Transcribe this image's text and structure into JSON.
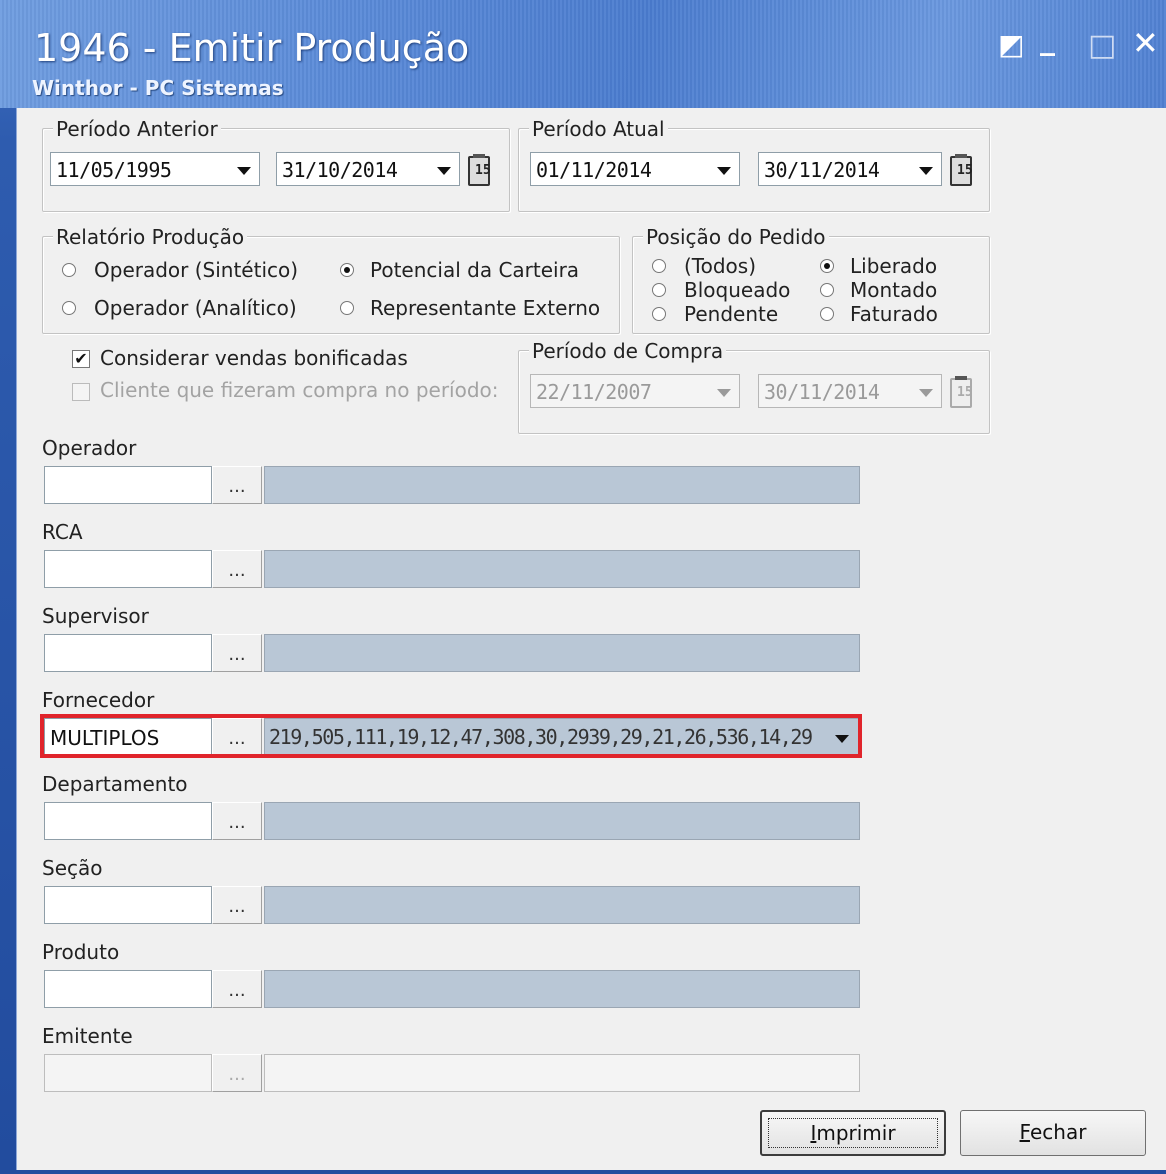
{
  "window": {
    "title": "1946 - Emitir Produção",
    "subtitle": "Winthor - PC Sistemas",
    "controls": {
      "restore": "◩",
      "minimize": "_",
      "maximize": "□",
      "close": "✕"
    }
  },
  "periodo_anterior": {
    "label": "Período Anterior",
    "start": "11/05/1995",
    "end": "31/10/2014"
  },
  "periodo_atual": {
    "label": "Período Atual",
    "start": "01/11/2014",
    "end": "30/11/2014"
  },
  "relatorio_producao": {
    "label": "Relatório Produção",
    "options": [
      "Operador (Sintético)",
      "Potencial da Carteira",
      "Operador (Analítico)",
      "Representante Externo"
    ],
    "selected": "Potencial da Carteira"
  },
  "posicao_pedido": {
    "label": "Posição do Pedido",
    "options": [
      "(Todos)",
      "Liberado",
      "Bloqueado",
      "Montado",
      "Pendente",
      "Faturado"
    ],
    "selected": "Liberado"
  },
  "checkboxes": {
    "vendas_bonificadas": {
      "label": "Considerar vendas bonificadas",
      "checked": true
    },
    "cliente_compra": {
      "label": "Cliente que fizeram compra no período:",
      "checked": false,
      "disabled": true
    }
  },
  "periodo_compra": {
    "label": "Período de Compra",
    "start": "22/11/2007",
    "end": "30/11/2014",
    "disabled": true
  },
  "filters": {
    "operador": {
      "label": "Operador",
      "code": "",
      "desc": ""
    },
    "rca": {
      "label": "RCA",
      "code": "",
      "desc": ""
    },
    "supervisor": {
      "label": "Supervisor",
      "code": "",
      "desc": ""
    },
    "fornecedor": {
      "label": "Fornecedor",
      "code": "MULTIPLOS",
      "desc": "219,505,111,19,12,47,308,30,2939,29,21,26,536,14,29"
    },
    "departamento": {
      "label": "Departamento",
      "code": "",
      "desc": ""
    },
    "secao": {
      "label": "Seção",
      "code": "",
      "desc": ""
    },
    "produto": {
      "label": "Produto",
      "code": "",
      "desc": ""
    },
    "emitente": {
      "label": "Emitente",
      "code": "",
      "desc": "",
      "disabled": true
    }
  },
  "lookup_button": "...",
  "calendar_glyph": "15",
  "check_glyph": "✔",
  "buttons": {
    "imprimir": {
      "accel": "I",
      "rest": "mprimir"
    },
    "fechar": {
      "accel": "F",
      "rest": "echar"
    }
  },
  "colors": {
    "highlight": "#e0242b",
    "title_bar": "#5a8ad8",
    "desc_field": "#b9c7d6"
  }
}
